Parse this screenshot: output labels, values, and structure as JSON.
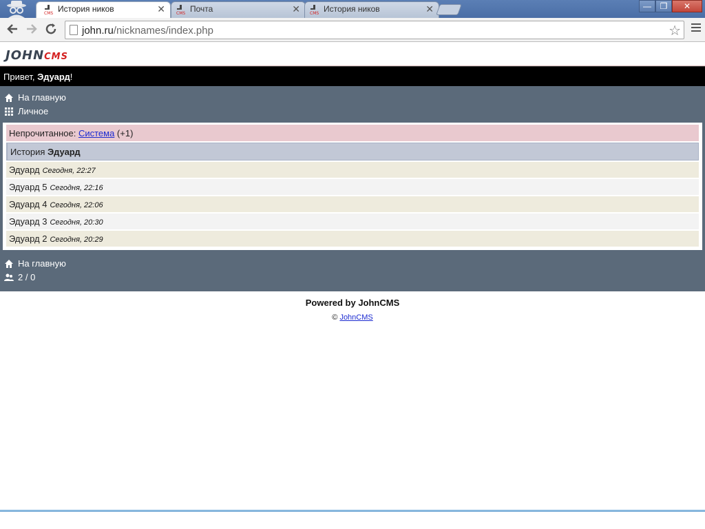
{
  "browser": {
    "tabs": [
      {
        "title": "История ников",
        "active": true
      },
      {
        "title": "Почта",
        "active": false
      },
      {
        "title": "История ников",
        "active": false
      }
    ],
    "close_glyph": "✕",
    "url_host": "john.ru",
    "url_path": "/nicknames/index.php",
    "win_minimize": "—",
    "win_maximize": "❐",
    "win_close": "✕"
  },
  "site": {
    "logo_main": "JOHN",
    "logo_cms": "CMS",
    "greeting_prefix": "Привет, ",
    "greeting_user": "Эдуард",
    "greeting_suffix": "!",
    "nav": [
      {
        "label": "На главную",
        "icon": "home-icon"
      },
      {
        "label": "Личное",
        "icon": "grid-icon"
      }
    ],
    "unread_label": "Непрочитанное: ",
    "unread_link": "Система",
    "unread_count": " (+1)",
    "history_label": "История ",
    "history_user": "Эдуард",
    "entries": [
      {
        "name": "Эдуард",
        "date": "Сегодня, 22:27"
      },
      {
        "name": "Эдуард 5",
        "date": "Сегодня, 22:16"
      },
      {
        "name": "Эдуард 4",
        "date": "Сегодня, 22:06"
      },
      {
        "name": "Эдуард 3",
        "date": "Сегодня, 20:30"
      },
      {
        "name": "Эдуард 2",
        "date": "Сегодня, 20:29"
      }
    ],
    "footer_home": "На главную",
    "footer_users": "2 / 0",
    "powered": "Powered by JohnCMS",
    "copy_symbol": "© ",
    "copy_link": "JohnCMS"
  }
}
